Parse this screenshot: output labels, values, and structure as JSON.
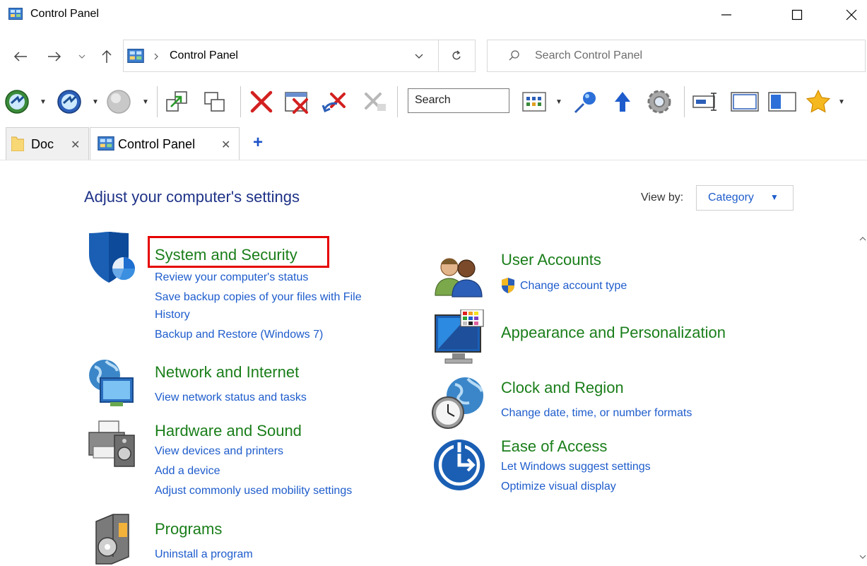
{
  "window": {
    "title": "Control Panel"
  },
  "address": {
    "crumb": "Control Panel"
  },
  "search": {
    "placeholder": "Search Control Panel"
  },
  "toolbar": {
    "search_label": "Search"
  },
  "tabs": [
    {
      "label": "Doc"
    },
    {
      "label": "Control Panel"
    }
  ],
  "main": {
    "heading": "Adjust your computer's settings",
    "view_by_label": "View by:",
    "view_by_value": "Category",
    "left_categories": [
      {
        "title": "System and Security",
        "links": [
          "Review your computer's status",
          "Save backup copies of your files with File",
          "History",
          "Backup and Restore (Windows 7)"
        ]
      },
      {
        "title": "Network and Internet",
        "links": [
          "View network status and tasks"
        ]
      },
      {
        "title": "Hardware and Sound",
        "links": [
          "View devices and printers",
          "Add a device",
          "Adjust commonly used mobility settings"
        ]
      },
      {
        "title": "Programs",
        "links": [
          "Uninstall a program"
        ]
      }
    ],
    "right_categories": [
      {
        "title": "User Accounts",
        "links": [
          "Change account type"
        ]
      },
      {
        "title": "Appearance and Personalization",
        "links": []
      },
      {
        "title": "Clock and Region",
        "links": [
          "Change date, time, or number formats"
        ]
      },
      {
        "title": "Ease of Access",
        "links": [
          "Let Windows suggest settings",
          "Optimize visual display"
        ]
      }
    ]
  },
  "colors": {
    "category_green": "#1a7e1a",
    "link_blue": "#1e5ccc",
    "heading_blue": "#1e3287",
    "highlight_red": "#e60000"
  }
}
